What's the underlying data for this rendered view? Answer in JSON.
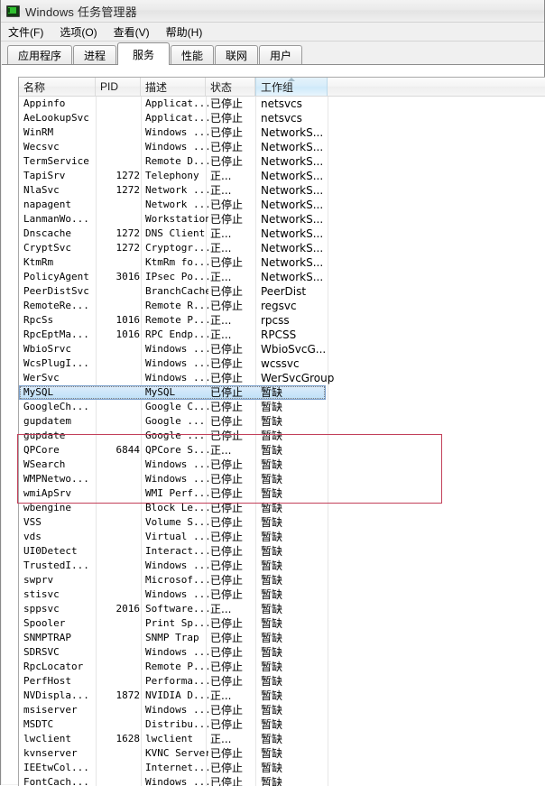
{
  "window": {
    "title": "Windows 任务管理器",
    "icon": "task-manager-icon"
  },
  "menu": {
    "items": [
      {
        "label": "文件(F)",
        "accel": "F"
      },
      {
        "label": "选项(O)",
        "accel": "O"
      },
      {
        "label": "查看(V)",
        "accel": "V"
      },
      {
        "label": "帮助(H)",
        "accel": "H"
      }
    ]
  },
  "tabs": {
    "active": "服务",
    "items": [
      {
        "label": "应用程序"
      },
      {
        "label": "进程"
      },
      {
        "label": "服务"
      },
      {
        "label": "性能"
      },
      {
        "label": "联网"
      },
      {
        "label": "用户"
      }
    ]
  },
  "table": {
    "columns": [
      {
        "key": "name",
        "label": "名称",
        "sorted": false
      },
      {
        "key": "pid",
        "label": "PID",
        "sorted": false
      },
      {
        "key": "desc",
        "label": "描述",
        "sorted": false
      },
      {
        "key": "status",
        "label": "状态",
        "sorted": false
      },
      {
        "key": "group",
        "label": "工作组",
        "sorted": true,
        "sort_direction": "ascending"
      }
    ],
    "selected_row": "MySQL",
    "rows": [
      {
        "name": "Appinfo",
        "pid": "",
        "desc": "Applicat...",
        "status": "已停止",
        "group": "netsvcs"
      },
      {
        "name": "AeLookupSvc",
        "pid": "",
        "desc": "Applicat...",
        "status": "已停止",
        "group": "netsvcs"
      },
      {
        "name": "WinRM",
        "pid": "",
        "desc": "Windows ...",
        "status": "已停止",
        "group": "NetworkS..."
      },
      {
        "name": "Wecsvc",
        "pid": "",
        "desc": "Windows ...",
        "status": "已停止",
        "group": "NetworkS..."
      },
      {
        "name": "TermService",
        "pid": "",
        "desc": "Remote D...",
        "status": "已停止",
        "group": "NetworkS..."
      },
      {
        "name": "TapiSrv",
        "pid": "1272",
        "desc": "Telephony",
        "status": "正...",
        "group": "NetworkS..."
      },
      {
        "name": "NlaSvc",
        "pid": "1272",
        "desc": "Network ...",
        "status": "正...",
        "group": "NetworkS..."
      },
      {
        "name": "napagent",
        "pid": "",
        "desc": "Network ...",
        "status": "已停止",
        "group": "NetworkS..."
      },
      {
        "name": "LanmanWo...",
        "pid": "",
        "desc": "Workstation",
        "status": "已停止",
        "group": "NetworkS..."
      },
      {
        "name": "Dnscache",
        "pid": "1272",
        "desc": "DNS Client",
        "status": "正...",
        "group": "NetworkS..."
      },
      {
        "name": "CryptSvc",
        "pid": "1272",
        "desc": "Cryptogr...",
        "status": "正...",
        "group": "NetworkS..."
      },
      {
        "name": "KtmRm",
        "pid": "",
        "desc": "KtmRm fo...",
        "status": "已停止",
        "group": "NetworkS..."
      },
      {
        "name": "PolicyAgent",
        "pid": "3016",
        "desc": "IPsec Po...",
        "status": "正...",
        "group": "NetworkS..."
      },
      {
        "name": "PeerDistSvc",
        "pid": "",
        "desc": "BranchCache",
        "status": "已停止",
        "group": "PeerDist"
      },
      {
        "name": "RemoteRe...",
        "pid": "",
        "desc": "Remote R...",
        "status": "已停止",
        "group": "regsvc"
      },
      {
        "name": "RpcSs",
        "pid": "1016",
        "desc": "Remote P...",
        "status": "正...",
        "group": "rpcss"
      },
      {
        "name": "RpcEptMa...",
        "pid": "1016",
        "desc": "RPC Endp...",
        "status": "正...",
        "group": "RPCSS"
      },
      {
        "name": "WbioSrvc",
        "pid": "",
        "desc": "Windows ...",
        "status": "已停止",
        "group": "WbioSvcG..."
      },
      {
        "name": "WcsPlugI...",
        "pid": "",
        "desc": "Windows ...",
        "status": "已停止",
        "group": "wcssvc"
      },
      {
        "name": "WerSvc",
        "pid": "",
        "desc": "Windows ...",
        "status": "已停止",
        "group": "WerSvcGroup"
      },
      {
        "name": "MySQL",
        "pid": "",
        "desc": "MySQL",
        "status": "已停止",
        "group": "暂缺"
      },
      {
        "name": "GoogleCh...",
        "pid": "",
        "desc": "Google C...",
        "status": "已停止",
        "group": "暂缺"
      },
      {
        "name": "gupdatem",
        "pid": "",
        "desc": "Google ...",
        "status": "已停止",
        "group": "暂缺"
      },
      {
        "name": "gupdate",
        "pid": "",
        "desc": "Google ...",
        "status": "已停止",
        "group": "暂缺"
      },
      {
        "name": "QPCore",
        "pid": "6844",
        "desc": "QPCore S...",
        "status": "正...",
        "group": "暂缺"
      },
      {
        "name": "WSearch",
        "pid": "",
        "desc": "Windows ...",
        "status": "已停止",
        "group": "暂缺"
      },
      {
        "name": "WMPNetwo...",
        "pid": "",
        "desc": "Windows ...",
        "status": "已停止",
        "group": "暂缺"
      },
      {
        "name": "wmiApSrv",
        "pid": "",
        "desc": "WMI Perf...",
        "status": "已停止",
        "group": "暂缺"
      },
      {
        "name": "wbengine",
        "pid": "",
        "desc": "Block Le...",
        "status": "已停止",
        "group": "暂缺"
      },
      {
        "name": "VSS",
        "pid": "",
        "desc": "Volume S...",
        "status": "已停止",
        "group": "暂缺"
      },
      {
        "name": "vds",
        "pid": "",
        "desc": "Virtual ...",
        "status": "已停止",
        "group": "暂缺"
      },
      {
        "name": "UI0Detect",
        "pid": "",
        "desc": "Interact...",
        "status": "已停止",
        "group": "暂缺"
      },
      {
        "name": "TrustedI...",
        "pid": "",
        "desc": "Windows ...",
        "status": "已停止",
        "group": "暂缺"
      },
      {
        "name": "swprv",
        "pid": "",
        "desc": "Microsof...",
        "status": "已停止",
        "group": "暂缺"
      },
      {
        "name": "stisvc",
        "pid": "",
        "desc": "Windows ...",
        "status": "已停止",
        "group": "暂缺"
      },
      {
        "name": "sppsvc",
        "pid": "2016",
        "desc": "Software...",
        "status": "正...",
        "group": "暂缺"
      },
      {
        "name": "Spooler",
        "pid": "",
        "desc": "Print Sp...",
        "status": "已停止",
        "group": "暂缺"
      },
      {
        "name": "SNMPTRAP",
        "pid": "",
        "desc": "SNMP Trap",
        "status": "已停止",
        "group": "暂缺"
      },
      {
        "name": "SDRSVC",
        "pid": "",
        "desc": "Windows ...",
        "status": "已停止",
        "group": "暂缺"
      },
      {
        "name": "RpcLocator",
        "pid": "",
        "desc": "Remote P...",
        "status": "已停止",
        "group": "暂缺"
      },
      {
        "name": "PerfHost",
        "pid": "",
        "desc": "Performa...",
        "status": "已停止",
        "group": "暂缺"
      },
      {
        "name": "NVDispla...",
        "pid": "1872",
        "desc": "NVIDIA D...",
        "status": "正...",
        "group": "暂缺"
      },
      {
        "name": "msiserver",
        "pid": "",
        "desc": "Windows ...",
        "status": "已停止",
        "group": "暂缺"
      },
      {
        "name": "MSDTC",
        "pid": "",
        "desc": "Distribu...",
        "status": "已停止",
        "group": "暂缺"
      },
      {
        "name": "lwclient",
        "pid": "1628",
        "desc": "lwclient",
        "status": "正...",
        "group": "暂缺"
      },
      {
        "name": "kvnserver",
        "pid": "",
        "desc": "KVNC Server",
        "status": "已停止",
        "group": "暂缺"
      },
      {
        "name": "IEEtwCol...",
        "pid": "",
        "desc": "Internet...",
        "status": "已停止",
        "group": "暂缺"
      },
      {
        "name": "FontCach...",
        "pid": "",
        "desc": "Windows ...",
        "status": "已停止",
        "group": "暂缺"
      }
    ]
  },
  "annotation": {
    "highlight_box": {
      "color": "#c2405a",
      "covers_rows": [
        "WcsPlugI...",
        "WerSvc",
        "MySQL",
        "GoogleCh...",
        "gupdatem",
        "gupdate"
      ]
    }
  }
}
